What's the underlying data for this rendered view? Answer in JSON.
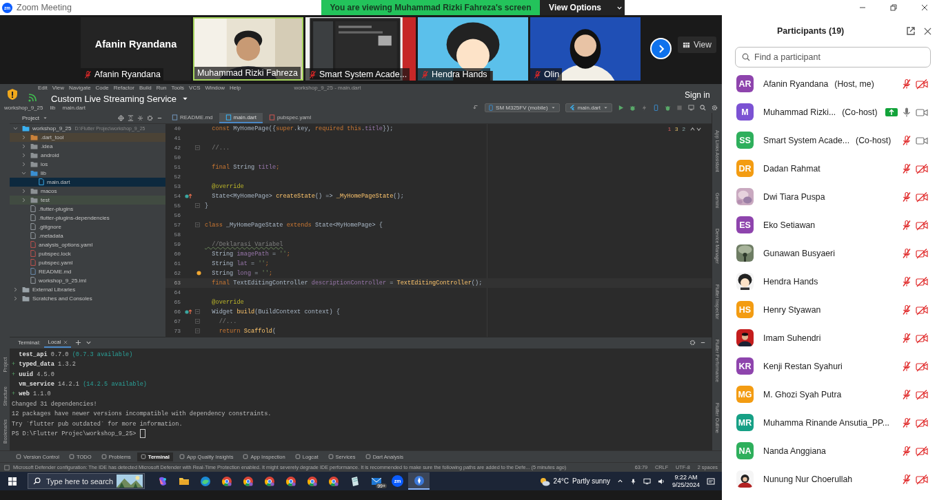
{
  "window": {
    "title": "Zoom Meeting",
    "logo": "zm"
  },
  "share_banner": {
    "text": "You are viewing Muhammad Rizki Fahreza's screen",
    "button": "View Options"
  },
  "video_strip": {
    "tiles": [
      {
        "kind": "name",
        "name": "Afanin Ryandana",
        "label": "Afanin Ryandana",
        "muted": true,
        "speaking": false
      },
      {
        "kind": "picture",
        "label": "Muhammad Rizki Fahreza",
        "muted": false,
        "speaking": true
      },
      {
        "kind": "picture",
        "label": "Smart System Acade...",
        "muted": true,
        "speaking": false
      },
      {
        "kind": "picture",
        "label": "Hendra Hands",
        "muted": true,
        "speaking": false
      },
      {
        "kind": "picture",
        "label": "Olin",
        "muted": true,
        "speaking": false
      }
    ],
    "view_button": "View"
  },
  "screen_share": {
    "toolbar_title": "Custom Live Streaming Service",
    "sign_in": "Sign in"
  },
  "ide": {
    "menu": [
      "Edit",
      "View",
      "Navigate",
      "Code",
      "Refactor",
      "Build",
      "Run",
      "Tools",
      "VCS",
      "Window",
      "Help"
    ],
    "title": "workshop_9_25 - main.dart",
    "breadcrumb": [
      "workshop_9_25",
      "lib",
      "main.dart"
    ],
    "device": "SM M325FV (mobile)",
    "run_config": "main.dart",
    "project_header": "Project",
    "tabs": [
      {
        "label": "README.md",
        "kind": "md",
        "selected": false
      },
      {
        "label": "main.dart",
        "kind": "dart",
        "selected": true
      },
      {
        "label": "pubspec.yaml",
        "kind": "yaml",
        "selected": false
      }
    ],
    "project_tree": [
      {
        "label": "workshop_9_25",
        "path": "D:\\Flutter Projec\\workshop_9_25",
        "kind": "module",
        "expanded": true,
        "selected": false,
        "children": [
          {
            "label": ".dart_tool",
            "kind": "excluded",
            "expanded": false,
            "selected": false
          },
          {
            "label": ".idea",
            "kind": "folder",
            "expanded": false,
            "selected": false
          },
          {
            "label": "android",
            "kind": "folder",
            "expanded": false,
            "selected": false
          },
          {
            "label": "ios",
            "kind": "folder",
            "expanded": false,
            "selected": false
          },
          {
            "label": "lib",
            "kind": "source",
            "expanded": true,
            "selected": false,
            "children": [
              {
                "label": "main.dart",
                "kind": "dart",
                "selected": true
              }
            ]
          },
          {
            "label": "macos",
            "kind": "folder",
            "expanded": false,
            "selected": false
          },
          {
            "label": "test",
            "kind": "test",
            "expanded": false,
            "selected": false
          },
          {
            "label": ".flutter-plugins",
            "kind": "file",
            "selected": false
          },
          {
            "label": ".flutter-plugins-dependencies",
            "kind": "file",
            "selected": false
          },
          {
            "label": ".gitignore",
            "kind": "file",
            "selected": false
          },
          {
            "label": ".metadata",
            "kind": "file",
            "selected": false
          },
          {
            "label": "analysis_options.yaml",
            "kind": "yaml",
            "selected": false
          },
          {
            "label": "pubspec.lock",
            "kind": "yaml",
            "selected": false
          },
          {
            "label": "pubspec.yaml",
            "kind": "yaml",
            "selected": false
          },
          {
            "label": "README.md",
            "kind": "md",
            "selected": false
          },
          {
            "label": "workshop_9_25.iml",
            "kind": "file",
            "selected": false
          }
        ]
      },
      {
        "label": "External Libraries",
        "kind": "libraries",
        "expanded": false,
        "selected": false
      },
      {
        "label": "Scratches and Consoles",
        "kind": "scratches",
        "expanded": false,
        "selected": false
      }
    ],
    "inspections": {
      "errors": "1",
      "warnings": "3",
      "weak_warnings": "2"
    },
    "code": [
      {
        "num": "40",
        "current": false,
        "segs": [
          {
            "t": "  const ",
            "kind": "kw"
          },
          {
            "t": "MyHomePage({",
            "kind": "plain"
          },
          {
            "t": "super",
            "kind": "kw"
          },
          {
            "t": ".key, ",
            "kind": "plain"
          },
          {
            "t": "required this",
            "kind": "kw"
          },
          {
            "t": ".",
            "kind": "plain"
          },
          {
            "t": "title",
            "kind": "field"
          },
          {
            "t": "});",
            "kind": "plain"
          }
        ]
      },
      {
        "num": "41",
        "current": false
      },
      {
        "num": "42",
        "current": false,
        "fold": true,
        "segs": [
          {
            "t": "  //...",
            "kind": "comment"
          }
        ]
      },
      {
        "num": "50",
        "current": false
      },
      {
        "num": "51",
        "current": false,
        "segs": [
          {
            "t": "  final ",
            "kind": "kw"
          },
          {
            "t": "String ",
            "kind": "plain"
          },
          {
            "t": "title",
            "kind": "field"
          },
          {
            "t": ";",
            "kind": "kw"
          }
        ]
      },
      {
        "num": "52",
        "current": false
      },
      {
        "num": "53",
        "current": false,
        "segs": [
          {
            "t": "  @override",
            "kind": "ann"
          }
        ]
      },
      {
        "num": "54",
        "current": false,
        "override_marker": true,
        "segs": [
          {
            "t": "  State<MyHomePage> ",
            "kind": "plain"
          },
          {
            "t": "createState",
            "kind": "fn"
          },
          {
            "t": "() => ",
            "kind": "plain"
          },
          {
            "t": "_MyHomePageState",
            "kind": "fn"
          },
          {
            "t": "();",
            "kind": "plain"
          }
        ]
      },
      {
        "num": "55",
        "current": false,
        "fold": true,
        "segs": [
          {
            "t": "}",
            "kind": "plain"
          }
        ]
      },
      {
        "num": "56",
        "current": false
      },
      {
        "num": "57",
        "current": false,
        "fold": true,
        "segs": [
          {
            "t": "class ",
            "kind": "kw"
          },
          {
            "t": "_MyHomePageState ",
            "kind": "plain"
          },
          {
            "t": "extends ",
            "kind": "kw"
          },
          {
            "t": "State<MyHomePage> {",
            "kind": "plain"
          }
        ]
      },
      {
        "num": "58",
        "current": false
      },
      {
        "num": "59",
        "current": false,
        "segs": [
          {
            "t": "  //Deklarasi Variabel",
            "kind": "typo"
          }
        ]
      },
      {
        "num": "60",
        "current": false,
        "segs": [
          {
            "t": "  String ",
            "kind": "plain"
          },
          {
            "t": "imagePath",
            "kind": "field"
          },
          {
            "t": " = ",
            "kind": "plain"
          },
          {
            "t": "''",
            "kind": "str"
          },
          {
            "t": ";",
            "kind": "kw"
          }
        ]
      },
      {
        "num": "61",
        "current": false,
        "segs": [
          {
            "t": "  String ",
            "kind": "plain"
          },
          {
            "t": "lat",
            "kind": "field"
          },
          {
            "t": " = ",
            "kind": "plain"
          },
          {
            "t": "''",
            "kind": "str"
          },
          {
            "t": ";",
            "kind": "kw"
          }
        ]
      },
      {
        "num": "62",
        "current": false,
        "hint_bulb": true,
        "segs": [
          {
            "t": "  String ",
            "kind": "plain"
          },
          {
            "t": "long",
            "kind": "field"
          },
          {
            "t": " = ",
            "kind": "plain"
          },
          {
            "t": "''",
            "kind": "str"
          },
          {
            "t": ";",
            "kind": "kw"
          }
        ]
      },
      {
        "num": "63",
        "current": true,
        "segs": [
          {
            "t": "  final ",
            "kind": "kw"
          },
          {
            "t": "TextEditingController ",
            "kind": "plain"
          },
          {
            "t": "descriptionController",
            "kind": "field"
          },
          {
            "t": " = ",
            "kind": "plain"
          },
          {
            "t": "TextEditingController",
            "kind": "fn"
          },
          {
            "t": "();",
            "kind": "plain"
          }
        ]
      },
      {
        "num": "64",
        "current": false
      },
      {
        "num": "65",
        "current": false,
        "segs": [
          {
            "t": "  @override",
            "kind": "ann"
          }
        ]
      },
      {
        "num": "66",
        "current": false,
        "override_marker": true,
        "fold": true,
        "segs": [
          {
            "t": "  Widget ",
            "kind": "plain"
          },
          {
            "t": "build",
            "kind": "fn"
          },
          {
            "t": "(BuildContext context) {",
            "kind": "plain"
          }
        ]
      },
      {
        "num": "67",
        "current": false,
        "fold": true,
        "segs": [
          {
            "t": "    //...",
            "kind": "comment"
          }
        ]
      },
      {
        "num": "73",
        "current": false,
        "fold": true,
        "segs": [
          {
            "t": "    return ",
            "kind": "kw"
          },
          {
            "t": "Scaffold",
            "kind": "fn"
          },
          {
            "t": "(",
            "kind": "plain"
          }
        ]
      }
    ],
    "left_tool_labels": [
      "Project",
      "Structure",
      "Bookmarks"
    ],
    "right_tool_labels": [
      "App Links Assistant",
      "Gemini",
      "Device Manager",
      "Flutter Inspector",
      "Flutter Performance",
      "Flutter Outline"
    ],
    "terminal": {
      "title": "Terminal:",
      "tabs": [
        {
          "label": "Local",
          "selected": true
        }
      ],
      "lines": [
        {
          "cursor": false,
          "segs": [
            {
              "t": "  test_api",
              "kind": "pkg"
            },
            {
              "t": " 0.7.0 ",
              "kind": "plain"
            },
            {
              "t": "(0.7.3 available)",
              "kind": "note"
            }
          ]
        },
        {
          "cursor": false,
          "segs": [
            {
              "t": "+ ",
              "kind": "plus"
            },
            {
              "t": "typed_data",
              "kind": "pkg"
            },
            {
              "t": " 1.3.2",
              "kind": "plain"
            }
          ]
        },
        {
          "cursor": false,
          "segs": [
            {
              "t": "+ ",
              "kind": "plus"
            },
            {
              "t": "uuid",
              "kind": "pkg"
            },
            {
              "t": " 4.5.0",
              "kind": "plain"
            }
          ]
        },
        {
          "cursor": false,
          "segs": [
            {
              "t": "  vm_service",
              "kind": "pkg"
            },
            {
              "t": " 14.2.1 ",
              "kind": "plain"
            },
            {
              "t": "(14.2.5 available)",
              "kind": "note"
            }
          ]
        },
        {
          "cursor": false,
          "segs": [
            {
              "t": "+ ",
              "kind": "plus"
            },
            {
              "t": "web",
              "kind": "pkg"
            },
            {
              "t": " 1.1.0",
              "kind": "plain"
            }
          ]
        },
        {
          "cursor": false,
          "segs": [
            {
              "t": "Changed 31 dependencies!",
              "kind": "plain"
            }
          ]
        },
        {
          "cursor": false,
          "segs": [
            {
              "t": "12 packages have newer versions incompatible with dependency constraints.",
              "kind": "plain"
            }
          ]
        },
        {
          "cursor": false,
          "segs": [
            {
              "t": "Try `flutter pub outdated` for more information.",
              "kind": "plain"
            }
          ]
        },
        {
          "cursor": true,
          "segs": [
            {
              "t": "PS D:\\Flutter Projec\\workshop_9_25>",
              "kind": "plain"
            }
          ]
        }
      ]
    },
    "tool_tabs": [
      {
        "label": "Version Control",
        "selected": false
      },
      {
        "label": "TODO",
        "selected": false
      },
      {
        "label": "Problems",
        "selected": false
      },
      {
        "label": "Terminal",
        "selected": true
      },
      {
        "label": "App Quality Insights",
        "selected": false
      },
      {
        "label": "App Inspection",
        "selected": false
      },
      {
        "label": "Logcat",
        "selected": false
      },
      {
        "label": "Services",
        "selected": false
      },
      {
        "label": "Dart Analysis",
        "selected": false
      }
    ],
    "status": {
      "message": "Microsoft Defender configuration: The IDE has detected Microsoft Defender with Real-Time Protection enabled. It might severely degrade IDE performance. It is recommended to make sure the following paths are added to the Defe... (5 minutes ago)",
      "position": "63:79",
      "line_ending": "CRLF",
      "encoding": "UTF-8",
      "indent": "2 spaces"
    }
  },
  "taskbar": {
    "search_placeholder": "Type here to search",
    "apps": [
      {
        "kind": "copilot",
        "active": false
      },
      {
        "kind": "folder",
        "active": false
      },
      {
        "kind": "edge",
        "active": false
      },
      {
        "kind": "chrome",
        "active": false
      },
      {
        "kind": "chrome",
        "active": false
      },
      {
        "kind": "chrome",
        "active": false
      },
      {
        "kind": "chrome",
        "active": false
      },
      {
        "kind": "chrome",
        "active": false
      },
      {
        "kind": "chrome",
        "active": false
      },
      {
        "kind": "notepad",
        "active": false
      },
      {
        "kind": "mail",
        "badge": "99+",
        "active": false
      },
      {
        "kind": "zoom",
        "label": "zm",
        "active": false
      },
      {
        "kind": "app",
        "active": true
      }
    ],
    "weather": {
      "temp": "24°C",
      "text": "Partly sunny"
    },
    "time": "9:22 AM",
    "date": "9/25/2024"
  },
  "participants": {
    "title": "Participants (19)",
    "search_placeholder": "Find a participant",
    "list": [
      {
        "name": "Afanin Ryandana",
        "role": "(Host, me)",
        "avatar": {
          "kind": "initials",
          "text": "AR",
          "color": "#8e44ad"
        },
        "muted": true,
        "video_off": true,
        "sharing": false
      },
      {
        "name": "Muhammad Rizki...",
        "role": "(Co-host)",
        "avatar": {
          "kind": "initials",
          "text": "M",
          "color": "#7b52d3"
        },
        "muted": false,
        "video_off": false,
        "sharing": true
      },
      {
        "name": "Smart System Acade...",
        "role": "(Co-host)",
        "avatar": {
          "kind": "initials",
          "text": "SS",
          "color": "#2eaf5c"
        },
        "muted": true,
        "video_off": false,
        "sharing": false
      },
      {
        "name": "Dadan Rahmat",
        "avatar": {
          "kind": "initials",
          "text": "DR",
          "color": "#f39c12"
        },
        "muted": true,
        "video_off": true,
        "sharing": false
      },
      {
        "name": "Dwi Tiara Puspa",
        "muted": true,
        "video_off": true,
        "sharing": false
      },
      {
        "name": "Eko Setiawan",
        "avatar": {
          "kind": "initials",
          "text": "ES",
          "color": "#8e44ad"
        },
        "muted": true,
        "video_off": true,
        "sharing": false
      },
      {
        "name": "Gunawan Busyaeri",
        "muted": true,
        "video_off": true,
        "sharing": false
      },
      {
        "name": "Hendra Hands",
        "muted": true,
        "video_off": true,
        "sharing": false
      },
      {
        "name": "Henry Styawan",
        "avatar": {
          "kind": "initials",
          "text": "HS",
          "color": "#f39c12"
        },
        "muted": true,
        "video_off": true,
        "sharing": false
      },
      {
        "name": "Imam Suhendri",
        "muted": true,
        "video_off": true,
        "sharing": false
      },
      {
        "name": "Kenji Restan Syahuri",
        "avatar": {
          "kind": "initials",
          "text": "KR",
          "color": "#8e44ad"
        },
        "muted": true,
        "video_off": true,
        "sharing": false
      },
      {
        "name": "M. Ghozi Syah Putra",
        "avatar": {
          "kind": "initials",
          "text": "MG",
          "color": "#f39c12"
        },
        "muted": true,
        "video_off": true,
        "sharing": false
      },
      {
        "name": "Muhamma Rinande Ansutia_PP...",
        "avatar": {
          "kind": "initials",
          "text": "MR",
          "color": "#16a085"
        },
        "muted": true,
        "video_off": true,
        "sharing": false
      },
      {
        "name": "Nanda  Anggiana",
        "avatar": {
          "kind": "initials",
          "text": "NA",
          "color": "#2eaf5c"
        },
        "muted": true,
        "video_off": true,
        "sharing": false
      },
      {
        "name": "Nunung Nur Choerullah",
        "muted": true,
        "video_off": true,
        "sharing": false
      }
    ]
  }
}
